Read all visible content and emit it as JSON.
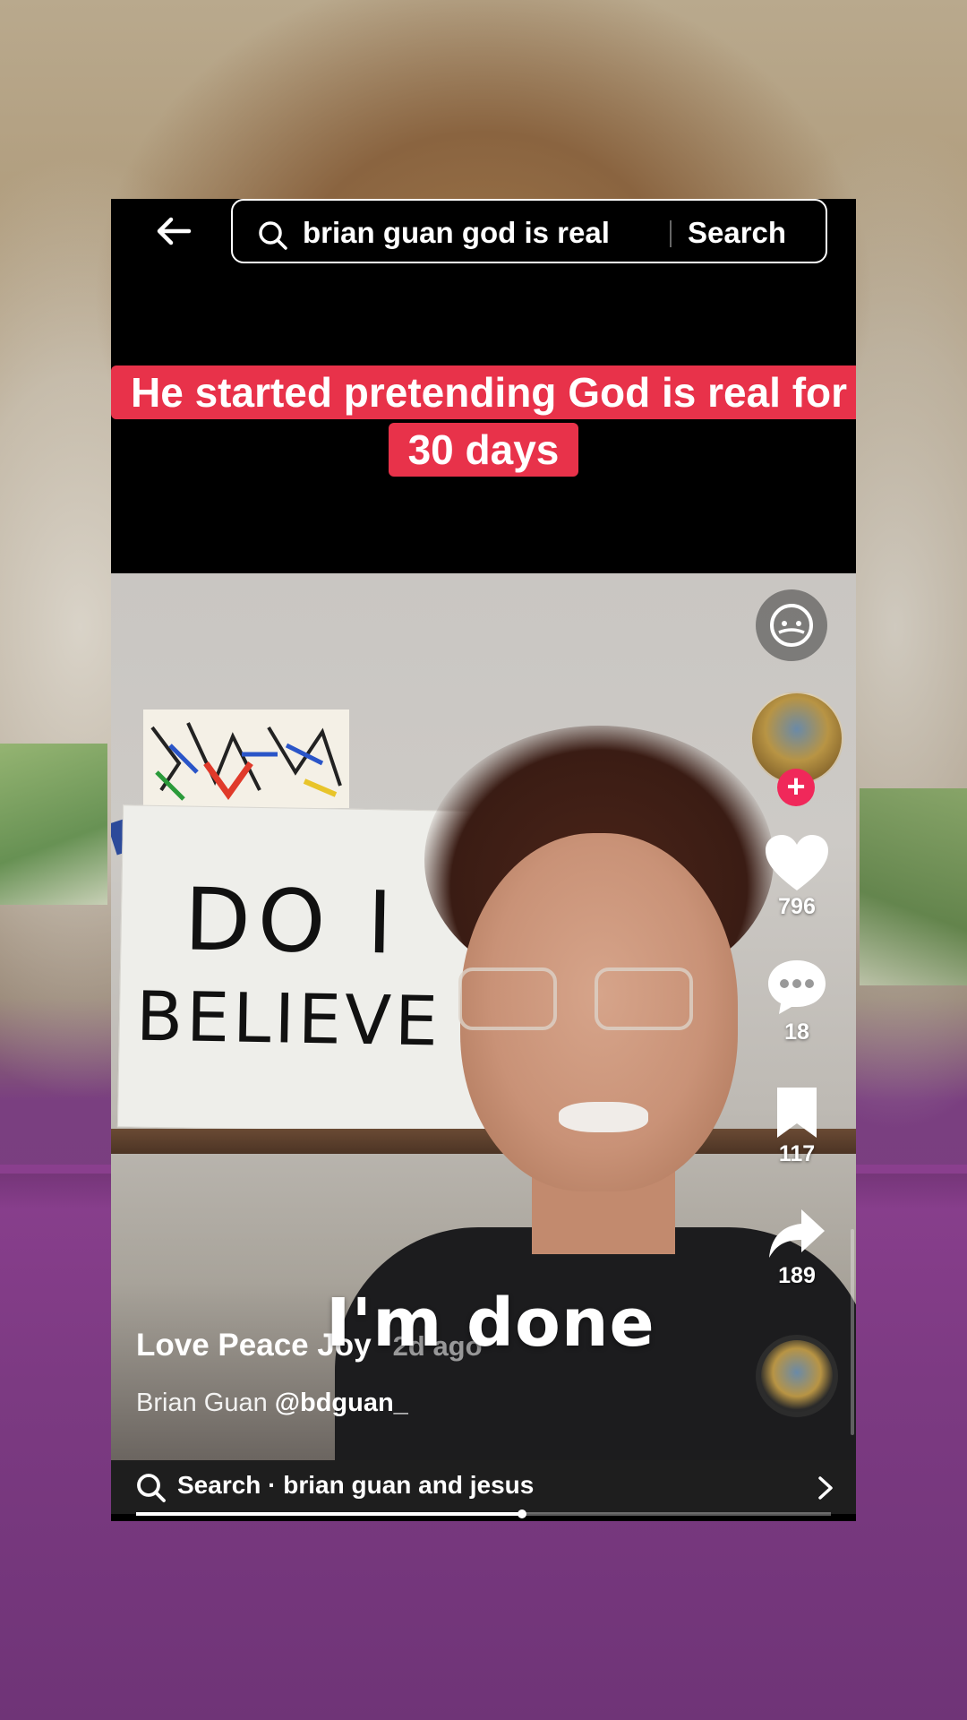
{
  "search": {
    "query": "brian guan god is real",
    "button_label": "Search"
  },
  "video": {
    "caption": "He started pretending God is real for 30 days",
    "subtitle": "I'm done",
    "title": "Love Peace Joy",
    "age": "2d ago",
    "author_name": "Brian Guan",
    "author_handle": "@bdguan_",
    "progress_fraction": 0.555,
    "poster_text_line1": "DO I",
    "poster_text_line2": "BELIEVE"
  },
  "actions": {
    "likes": "796",
    "comments": "18",
    "saves": "117",
    "shares": "189"
  },
  "related_search": {
    "label": "Search · brian guan and jesus"
  },
  "icons": {
    "back": "arrow-left-icon",
    "search": "search-icon",
    "like": "heart-icon",
    "comment": "comment-bubble-icon",
    "save": "bookmark-icon",
    "share": "share-arrow-icon",
    "follow": "plus-icon",
    "hat": "face-icon",
    "chevron": "chevron-right-icon"
  },
  "colors": {
    "caption_bg": "#e8324a",
    "follow_badge": "#f0285a",
    "app_bg": "#000000"
  }
}
